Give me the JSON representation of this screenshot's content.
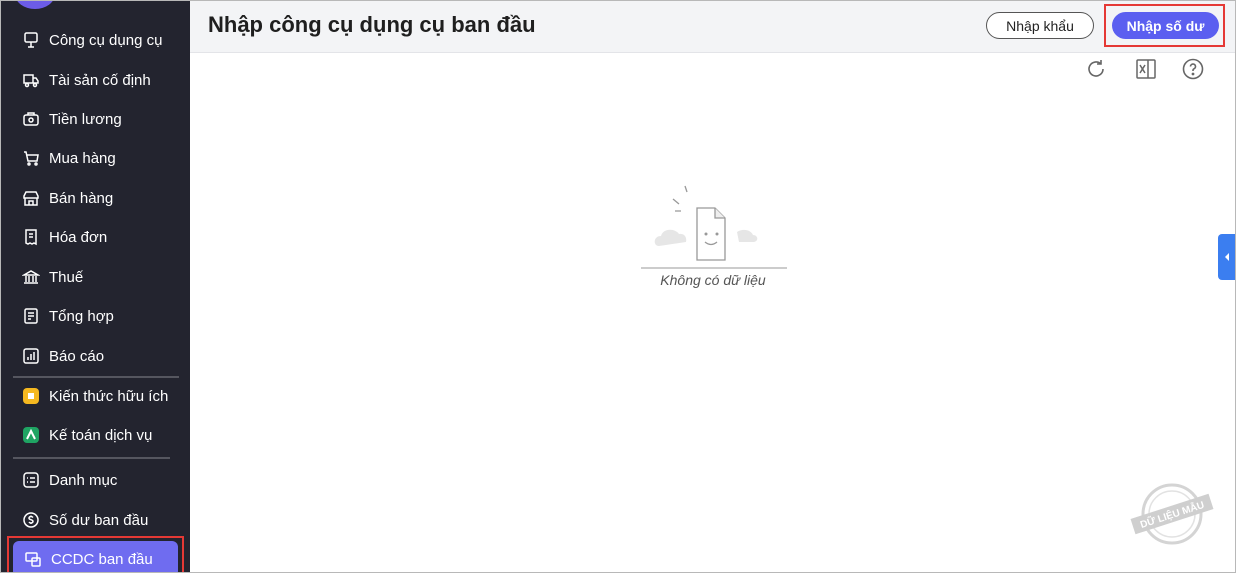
{
  "sidebar": {
    "items": [
      {
        "label": "Công cụ dụng cụ",
        "icon": "tools-icon"
      },
      {
        "label": "Tài sản cố định",
        "icon": "truck-icon"
      },
      {
        "label": "Tiền lương",
        "icon": "salary-bag-icon"
      },
      {
        "label": "Mua hàng",
        "icon": "cart-icon"
      },
      {
        "label": "Bán hàng",
        "icon": "store-icon"
      },
      {
        "label": "Hóa đơn",
        "icon": "invoice-icon"
      },
      {
        "label": "Thuế",
        "icon": "bank-icon"
      },
      {
        "label": "Tổng hợp",
        "icon": "summary-icon"
      },
      {
        "label": "Báo cáo",
        "icon": "report-chart-icon"
      }
    ],
    "extras": [
      {
        "label": "Kiến thức hữu ích",
        "icon": "knowledge-icon"
      },
      {
        "label": "Kế toán dịch vụ",
        "icon": "accounting-service-icon"
      }
    ],
    "settings": [
      {
        "label": "Danh mục",
        "icon": "catalog-icon"
      },
      {
        "label": "Số dư ban đầu",
        "icon": "opening-balance-icon"
      },
      {
        "label": "CCDC ban đầu",
        "icon": "initial-tools-icon",
        "active": true
      }
    ]
  },
  "header": {
    "title": "Nhập công cụ dụng cụ ban đầu",
    "import_label": "Nhập khẩu",
    "balance_label": "Nhập số dư"
  },
  "toolbar": {
    "icons": [
      "refresh-icon",
      "excel-export-icon",
      "help-icon"
    ]
  },
  "empty_state": {
    "text": "Không có dữ liệu"
  },
  "watermark": {
    "text": "DỮ LIỆU MẪU"
  },
  "colors": {
    "sidebar_bg": "#23242f",
    "accent": "#5b5ff0",
    "active_item": "#6f6cf0",
    "highlight": "#e53935",
    "side_tab": "#3b7ef0"
  }
}
